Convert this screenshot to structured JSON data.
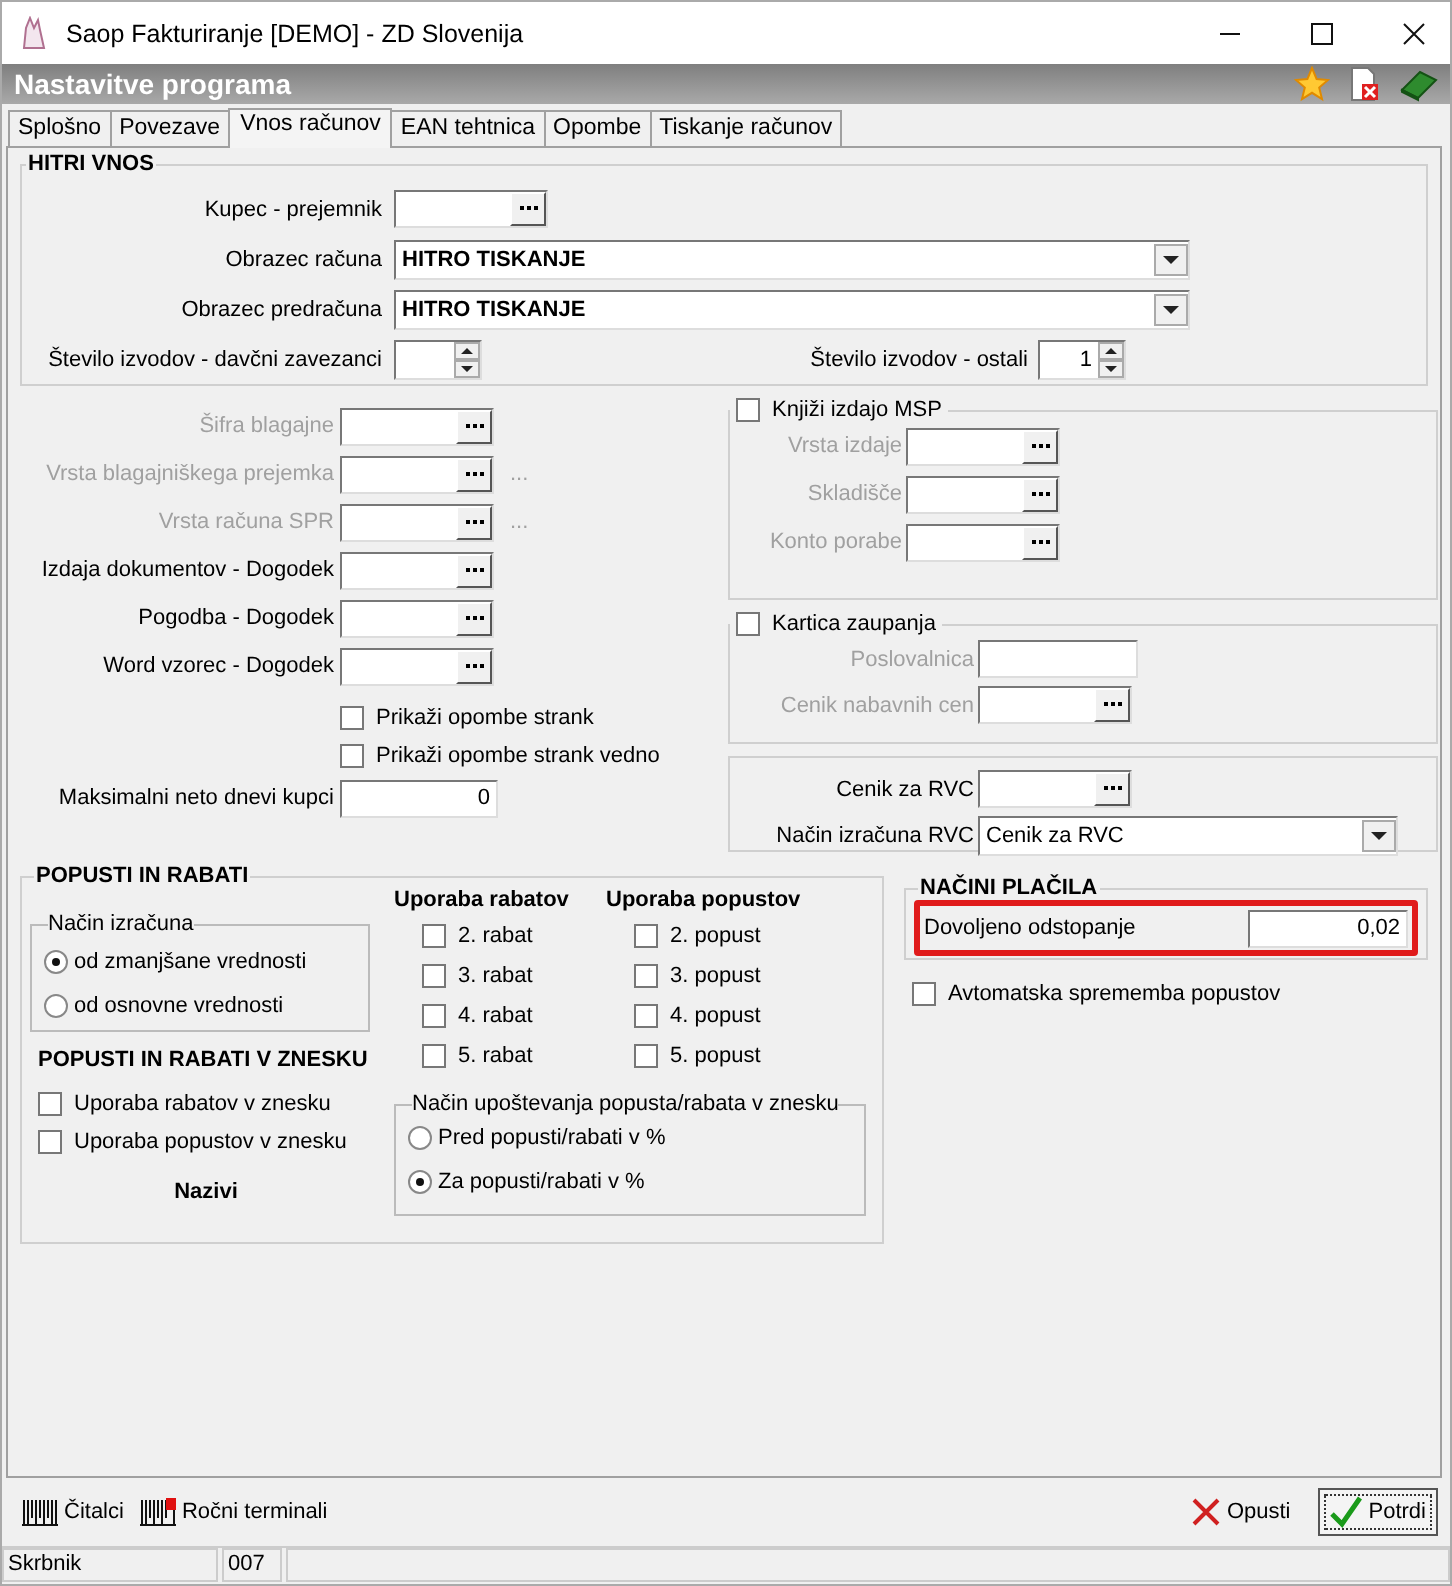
{
  "window": {
    "title": "Saop Fakturiranje [DEMO] - ZD Slovenija"
  },
  "header": {
    "title": "Nastavitve programa"
  },
  "tabs": [
    {
      "label": "Splošno",
      "selected": false
    },
    {
      "label": "Povezave",
      "selected": false
    },
    {
      "label": "Vnos računov",
      "selected": true
    },
    {
      "label": "EAN tehtnica",
      "selected": false
    },
    {
      "label": "Opombe",
      "selected": false
    },
    {
      "label": "Tiskanje računov",
      "selected": false
    }
  ],
  "quick_entry": {
    "title": "HITRI VNOS",
    "customer": {
      "label": "Kupec - prejemnik"
    },
    "invoice_form": {
      "label": "Obrazec računa",
      "value": "HITRO TISKANJE"
    },
    "proforma_form": {
      "label": "Obrazec predračuna",
      "value": "HITRO TISKANJE"
    },
    "copies_taxpayers": {
      "label": "Število izvodov - davčni zavezanci"
    },
    "copies_other": {
      "label": "Število izvodov - ostali",
      "value": "1"
    }
  },
  "documents": {
    "fields": [
      {
        "label": "Šifra blagajne",
        "disabled": true
      },
      {
        "label": "Vrsta blagajniškega prejemka",
        "disabled": true,
        "note": "..."
      },
      {
        "label": "Vrsta računa SPR",
        "disabled": true,
        "note": "..."
      },
      {
        "label": "Izdaja dokumentov - Dogodek",
        "disabled": false
      },
      {
        "label": "Pogodba - Dogodek",
        "disabled": false
      },
      {
        "label": "Word vzorec - Dogodek",
        "disabled": false
      }
    ],
    "checkboxes": [
      {
        "label": "Prikaži opombe strank",
        "checked": false
      },
      {
        "label": "Prikaži opombe strank vedno",
        "checked": false
      }
    ],
    "max_days": {
      "label": "Maksimalni neto dnevi kupci",
      "value": "0"
    }
  },
  "msp": {
    "label": "Knjiži izdajo MSP",
    "checked": false,
    "fields": [
      {
        "label": "Vrsta izdaje",
        "disabled": true
      },
      {
        "label": "Skladišče",
        "disabled": true
      },
      {
        "label": "Konto porabe",
        "disabled": true
      }
    ]
  },
  "trust_card": {
    "label": "Kartica zaupanja",
    "checked": false,
    "fields": [
      {
        "label": "Poslovalnica",
        "kind": "text",
        "disabled": true
      },
      {
        "label": "Cenik nabavnih cen",
        "kind": "lookup",
        "disabled": true
      }
    ]
  },
  "rvc": {
    "fields": [
      {
        "label": "Cenik za RVC",
        "kind": "lookup",
        "disabled": false
      },
      {
        "label": "Način izračuna RVC",
        "kind": "dropdown",
        "disabled": false,
        "value": "Cenik za RVC"
      }
    ]
  },
  "discounts": {
    "title": "POPUSTI IN RABATI",
    "calc": {
      "title": "Način izračuna",
      "options": [
        {
          "label": "od zmanjšane vrednosti",
          "selected": true
        },
        {
          "label": "od osnovne vrednosti",
          "selected": false
        }
      ]
    },
    "rebates": {
      "title": "Uporaba rabatov",
      "items": [
        {
          "label": "2. rabat",
          "checked": false
        },
        {
          "label": "3. rabat",
          "checked": false
        },
        {
          "label": "4. rabat",
          "checked": false
        },
        {
          "label": "5. rabat",
          "checked": false
        }
      ]
    },
    "discount_use": {
      "title": "Uporaba popustov",
      "items": [
        {
          "label": "2. popust",
          "checked": false
        },
        {
          "label": "3. popust",
          "checked": false
        },
        {
          "label": "4. popust",
          "checked": false
        },
        {
          "label": "5. popust",
          "checked": false
        }
      ]
    },
    "amount_title": "POPUSTI IN RABATI V ZNESKU",
    "amount_items": [
      {
        "label": "Uporaba rabatov v znesku",
        "checked": false
      },
      {
        "label": "Uporaba popustov v znesku",
        "checked": false
      }
    ],
    "names_label": "Nazivi",
    "amount_mode": {
      "title": "Način upoštevanja popusta/rabata v znesku",
      "options": [
        {
          "label": "Pred popusti/rabati v %",
          "selected": false
        },
        {
          "label": "Za popusti/rabati v %",
          "selected": true
        }
      ]
    }
  },
  "payment": {
    "title": "NAČINI PLAČILA",
    "label": "Dovoljeno odstopanje",
    "value": "0,02",
    "highlighted": true
  },
  "auto_discount": {
    "label": "Avtomatska sprememba popustov",
    "checked": false
  },
  "footer": {
    "tools": [
      {
        "label": "Čitalci",
        "kind": "reader"
      },
      {
        "label": "Ročni terminali",
        "kind": "terminal"
      }
    ],
    "actions": [
      {
        "label": "Opusti",
        "kind": "cancel",
        "default": false
      },
      {
        "label": "Potrdi",
        "kind": "ok",
        "default": true
      }
    ]
  },
  "status_bar": [
    "Skrbnik",
    "007"
  ]
}
